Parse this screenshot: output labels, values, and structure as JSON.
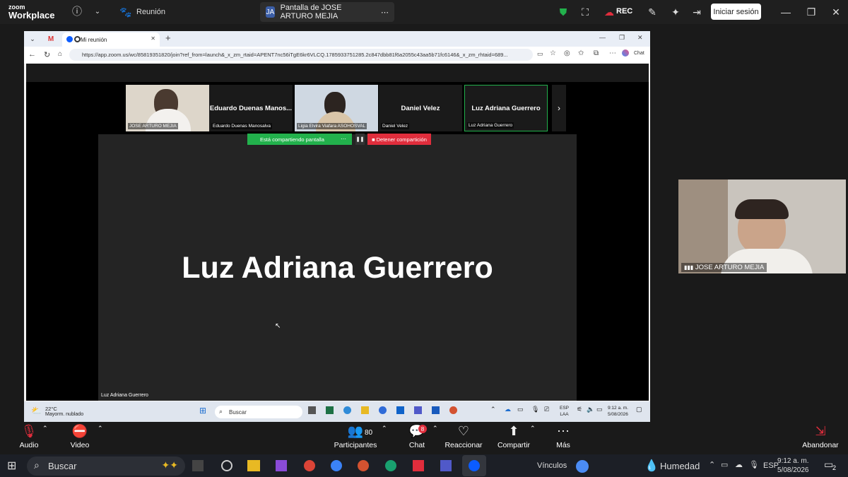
{
  "zoom_top": {
    "logo_line1": "zoom",
    "logo_line2": "Workplace",
    "meeting_label": "Reunión",
    "share_tab_initials": "JA",
    "share_tab_label": "Pantalla de JOSE ARTURO MEJIA",
    "rec_label": "REC",
    "signin_label": "Iniciar sesión"
  },
  "browser": {
    "tab_title": "Mi reunión",
    "url": "https://app.zoom.us/wc/85819351820/join?ref_from=launch&_x_zm_rtaid=APENT7nc56iTgE6kr6VLCQ.1785933751285.2c847dbb81f6a2055c43aa5b71fc6146&_x_zm_rhtaid=689...",
    "chat_label": "Chat"
  },
  "meeting": {
    "tiles": [
      {
        "name": "JOSE ARTURO MEJIA",
        "big": ""
      },
      {
        "name": "Eduardo Duenas Manosalva",
        "big": "Eduardo Duenas Manos..."
      },
      {
        "name": "Ligia Elvira Viafara ASOHOSVAL",
        "big": ""
      },
      {
        "name": "Daniel Velez",
        "big": "Daniel Velez"
      },
      {
        "name": "Luz Adriana Guerrero",
        "big": "Luz Adriana Guerrero"
      }
    ],
    "sharing_label": "Está compartiendo pantalla",
    "stop_share_label": "Detener compartición",
    "active_speaker": "Luz Adriana Guerrero",
    "stage_name": "Luz Adriana Guerrero"
  },
  "inner_taskbar": {
    "temp": "22°C",
    "weather": "Mayorm. nublado",
    "search": "Buscar",
    "lang1": "ESP",
    "lang2": "LAA",
    "time": "9:12 a. m.",
    "date": "5/08/2026"
  },
  "self_view": {
    "name": "JOSE ARTURO MEJIA"
  },
  "controls": {
    "audio": "Audio",
    "video": "Video",
    "participants": "Participantes",
    "participants_count": "80",
    "chat": "Chat",
    "chat_badge": "8",
    "react": "Reaccionar",
    "share": "Compartir",
    "more": "Más",
    "leave": "Abandonar"
  },
  "taskbar": {
    "search": "Buscar",
    "links": "Vínculos",
    "weather": "Humedad",
    "lang": "ESP",
    "time": "9:12 a. m.",
    "date": "5/08/2026",
    "notif_count": "2"
  },
  "colors": {
    "green": "#22b14c",
    "red": "#e02d3c",
    "zoom_blue": "#0b5cff"
  }
}
